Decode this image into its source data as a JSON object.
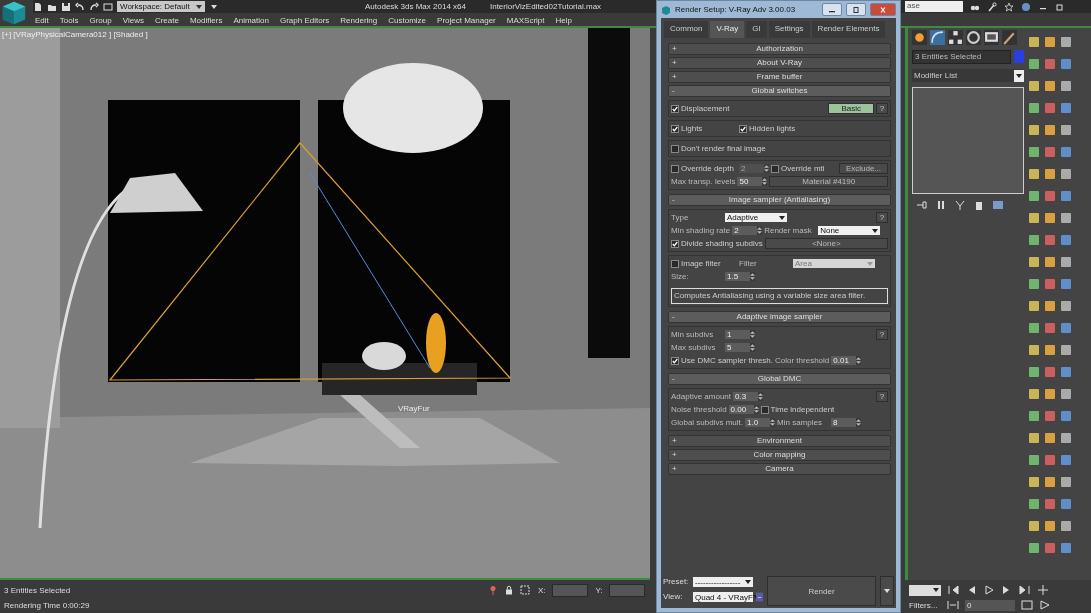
{
  "app": {
    "workspace": "Workspace: Default",
    "product": "Autodesk 3ds Max  2014 x64",
    "file": "InteriorVizEdited02Tutorial.max",
    "search": "ase"
  },
  "menu": [
    "Edit",
    "Tools",
    "Group",
    "Views",
    "Create",
    "Modifiers",
    "Animation",
    "Graph Editors",
    "Rendering",
    "Customize",
    "Project Manager",
    "MAXScript",
    "Help"
  ],
  "viewport": {
    "label": "[+] [VRayPhysicalCamera012 ] [Shaded ]",
    "object_label": "VRayFur"
  },
  "render_setup": {
    "title": "Render Setup: V-Ray Adv 3.00.03",
    "tabs": [
      {
        "label": "Common",
        "selected": false
      },
      {
        "label": "V-Ray",
        "selected": true
      },
      {
        "label": "GI",
        "selected": false
      },
      {
        "label": "Settings",
        "selected": false
      },
      {
        "label": "Render Elements",
        "selected": false
      }
    ],
    "rollouts": [
      {
        "sign": "+",
        "title": "Authorization",
        "expanded": false
      },
      {
        "sign": "+",
        "title": "About V-Ray",
        "expanded": false
      },
      {
        "sign": "+",
        "title": "Frame buffer",
        "expanded": false
      },
      {
        "sign": "-",
        "title": "Global switches",
        "expanded": true,
        "sections": [
          [
            [
              {
                "kind": "check",
                "label": "Displacement",
                "checked": true
              },
              {
                "kind": "button",
                "text": "Basic",
                "active": true
              },
              {
                "kind": "help",
                "text": "?"
              }
            ]
          ],
          [
            [
              {
                "kind": "check",
                "label": "Lights",
                "checked": true
              },
              {
                "kind": "check",
                "label": "Hidden lights",
                "checked": true
              }
            ]
          ],
          [
            [
              {
                "kind": "check",
                "label": "Don't render final image",
                "checked": false
              }
            ]
          ],
          [
            [
              {
                "kind": "check",
                "label": "Override depth",
                "checked": false
              },
              {
                "kind": "spin",
                "value": "2",
                "disabled": true
              },
              {
                "kind": "check",
                "label": "Override mtl",
                "checked": false
              },
              {
                "kind": "button",
                "text": "Exclude...",
                "active": false
              }
            ],
            [
              {
                "kind": "label",
                "text": "Max transp. levels"
              },
              {
                "kind": "spin",
                "value": "50",
                "disabled": false
              },
              {
                "kind": "button",
                "text": "Material #4190",
                "active": false
              }
            ]
          ]
        ]
      },
      {
        "sign": "-",
        "title": "Image sampler (Antialiasing)",
        "expanded": true,
        "sections": [
          [
            [
              {
                "kind": "label",
                "text": "Type"
              },
              {
                "kind": "drop",
                "value": "Adaptive",
                "disabled": false
              },
              {
                "kind": "help",
                "text": "?"
              }
            ],
            [
              {
                "kind": "label",
                "text": "Min shading rate"
              },
              {
                "kind": "spin",
                "value": "2",
                "disabled": false
              },
              {
                "kind": "label",
                "text": "Render mask"
              },
              {
                "kind": "drop",
                "value": "None",
                "disabled": false
              }
            ],
            [
              {
                "kind": "check",
                "label": "Divide shading subdivs",
                "checked": true
              },
              {
                "kind": "button",
                "text": "<None>",
                "active": false
              }
            ]
          ],
          [
            [
              {
                "kind": "check",
                "label": "Image filter",
                "checked": false
              },
              {
                "kind": "label",
                "text": "Filter"
              },
              {
                "kind": "drop",
                "value": "Area",
                "disabled": true
              }
            ],
            [
              {
                "kind": "label",
                "text": "Size:"
              },
              {
                "kind": "spin",
                "value": "1.5",
                "disabled": false
              }
            ],
            [
              {
                "kind": "note",
                "text": "Computes Antialiasing using a variable size area filter."
              }
            ]
          ]
        ]
      },
      {
        "sign": "-",
        "title": "Adaptive image sampler",
        "expanded": true,
        "sections": [
          [
            [
              {
                "kind": "label",
                "text": "Min subdivs"
              },
              {
                "kind": "spin",
                "value": "1",
                "disabled": false
              },
              {
                "kind": "help",
                "text": "?"
              }
            ],
            [
              {
                "kind": "label",
                "text": "Max subdivs"
              },
              {
                "kind": "spin",
                "value": "5",
                "disabled": false
              }
            ],
            [
              {
                "kind": "check",
                "label": "Use DMC sampler thresh.",
                "checked": true
              },
              {
                "kind": "label",
                "text": "Color threshold"
              },
              {
                "kind": "spin",
                "value": "0.01",
                "disabled": false
              }
            ]
          ]
        ]
      },
      {
        "sign": "-",
        "title": "Global DMC",
        "expanded": true,
        "sections": [
          [
            [
              {
                "kind": "label",
                "text": "Adaptive amount"
              },
              {
                "kind": "spin",
                "value": "0.3",
                "disabled": false
              },
              {
                "kind": "help",
                "text": "?"
              }
            ],
            [
              {
                "kind": "label",
                "text": "Noise threshold"
              },
              {
                "kind": "spin",
                "value": "0.00",
                "disabled": false
              },
              {
                "kind": "check",
                "label": "Time independent",
                "checked": false
              }
            ],
            [
              {
                "kind": "label",
                "text": "Global subdivs mult."
              },
              {
                "kind": "spin",
                "value": "1.0",
                "disabled": false
              },
              {
                "kind": "label",
                "text": "Min samples"
              },
              {
                "kind": "spin",
                "value": "8",
                "disabled": false
              }
            ]
          ]
        ]
      },
      {
        "sign": "+",
        "title": "Environment",
        "expanded": false
      },
      {
        "sign": "+",
        "title": "Color mapping",
        "expanded": false
      },
      {
        "sign": "+",
        "title": "Camera",
        "expanded": false
      }
    ],
    "preset_label": "Preset:",
    "preset": "-----------------",
    "view_label": "View:",
    "view": "Quad 4 - VRayF",
    "render_button": "Render"
  },
  "command_panel": {
    "selection": "3 Entities Selected",
    "modifier_list": "Modifier List"
  },
  "status_bar": {
    "selection": "3 Entities Selected",
    "render_time": "Rendering Time  0:00:29",
    "x_label": "X:",
    "y_label": "Y:"
  },
  "timeline": {
    "filters": "Filters...",
    "frame": "0"
  }
}
